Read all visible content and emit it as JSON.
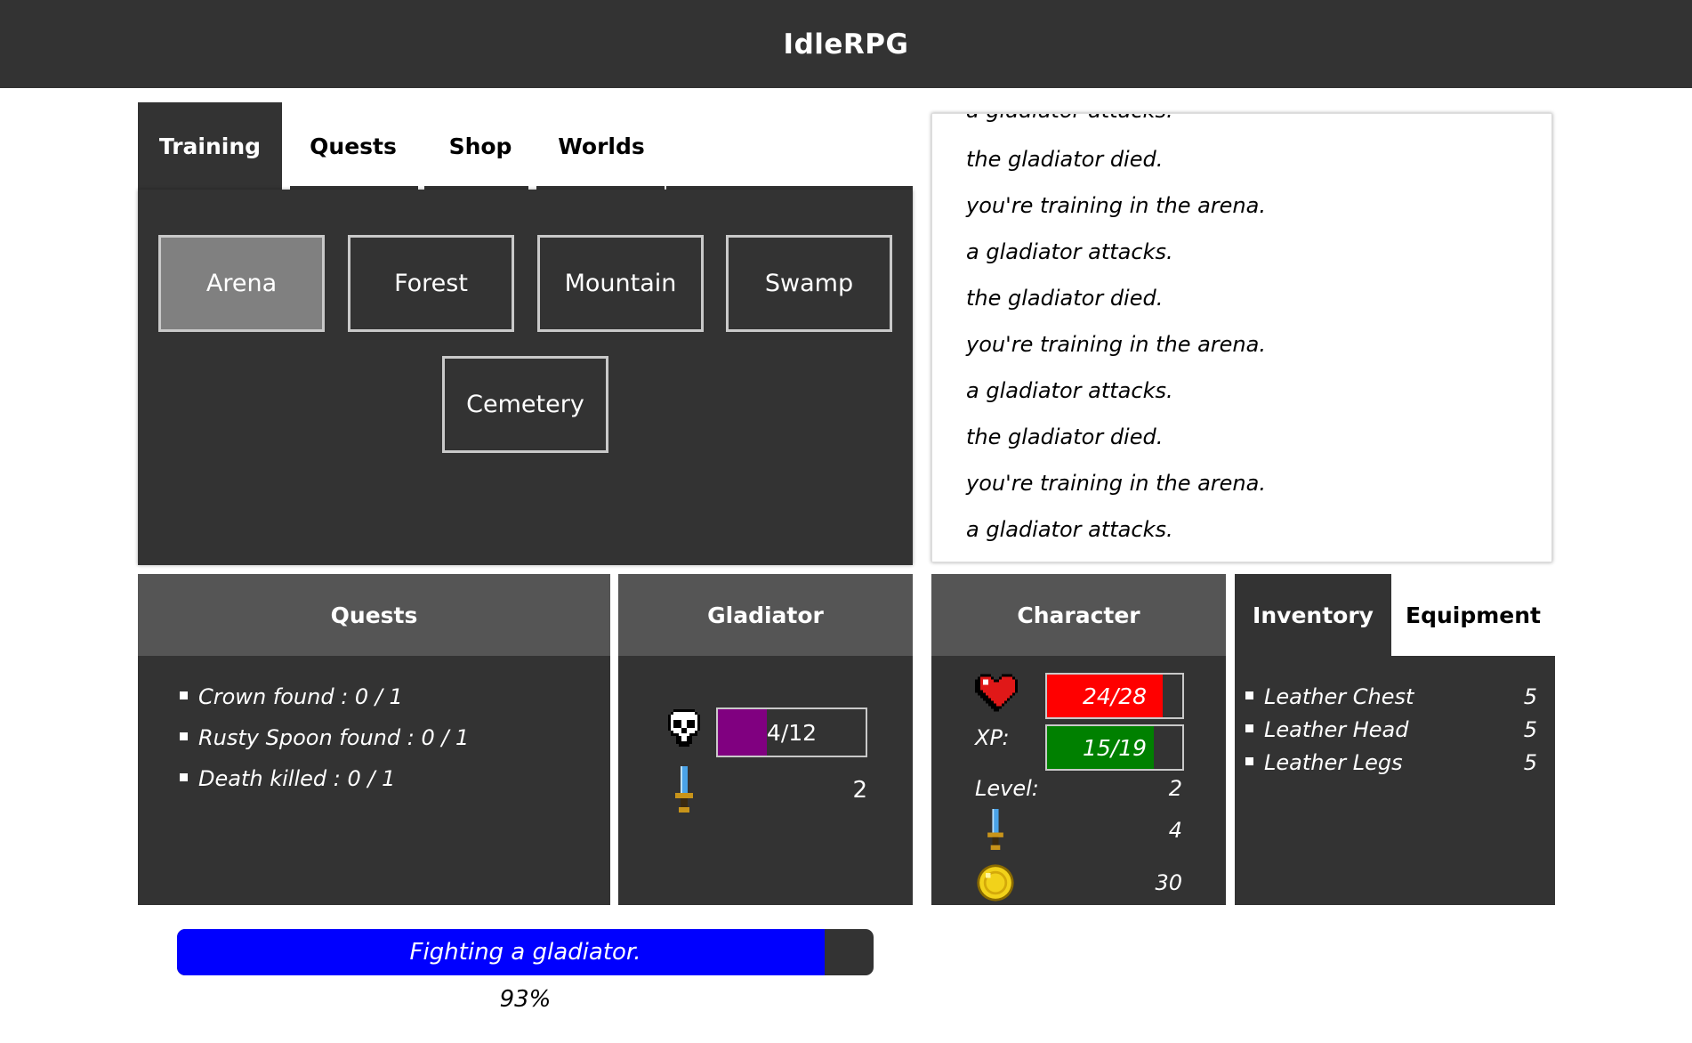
{
  "app": {
    "title": "IdleRPG"
  },
  "tabs": [
    "Training",
    "Quests",
    "Shop",
    "Worlds"
  ],
  "active_tab": "Training",
  "locations": [
    "Arena",
    "Forest",
    "Mountain",
    "Swamp",
    "Cemetery"
  ],
  "selected_location": "Arena",
  "log": {
    "partial_top": "a gladiator attacks.",
    "lines": [
      "the gladiator died.",
      "you're training in the arena.",
      "a gladiator attacks.",
      "the gladiator died.",
      "you're training in the arena.",
      "a gladiator attacks.",
      "the gladiator died.",
      "you're training in the arena.",
      "a gladiator attacks."
    ]
  },
  "quests_panel": {
    "title": "Quests",
    "items": [
      "Crown found : 0 / 1",
      "Rusty Spoon found : 0 / 1",
      "Death killed : 0 / 1"
    ]
  },
  "enemy": {
    "title": "Gladiator",
    "hp_label": "4/12",
    "hp_fraction": 0.333,
    "hp_color": "#800080",
    "attack": "2",
    "icons": [
      "skull-icon",
      "sword-icon"
    ]
  },
  "character": {
    "title": "Character",
    "hp_label": "24/28",
    "hp_fraction": 0.857,
    "hp_color": "#ff0000",
    "xp_label_text": "XP:",
    "xp_label": "15/19",
    "xp_fraction": 0.789,
    "xp_color": "#008000",
    "level_label": "Level:",
    "level": "2",
    "attack": "4",
    "gold": "30",
    "icons": [
      "heart-icon",
      "sword-icon",
      "gold-coin-icon"
    ]
  },
  "inventory": {
    "tabs": [
      "Inventory",
      "Equipment"
    ],
    "active_tab": "Inventory",
    "items": [
      {
        "name": "Leather Chest",
        "value": "5"
      },
      {
        "name": "Leather Head",
        "value": "5"
      },
      {
        "name": "Leather Legs",
        "value": "5"
      }
    ]
  },
  "action": {
    "label": "Fighting a gladiator.",
    "percent_text": "93%",
    "fraction": 0.93,
    "color": "#0000ff"
  }
}
